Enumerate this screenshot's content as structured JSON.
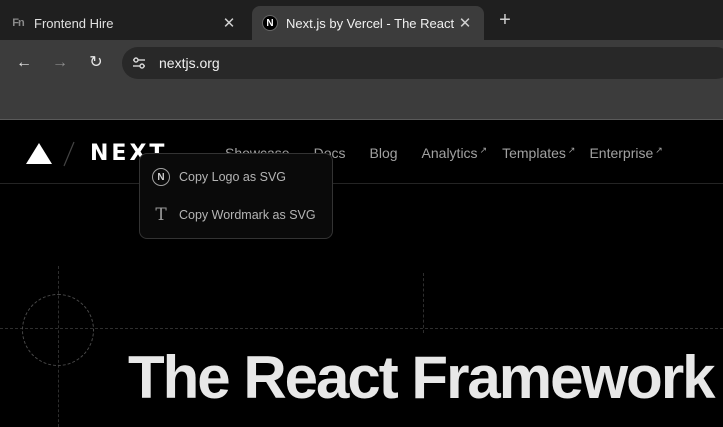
{
  "tabs": [
    {
      "favicon": "Fn",
      "title": "Frontend Hire",
      "close": "✕",
      "active": false
    },
    {
      "favicon": "N",
      "title": "Next.js by Vercel - The React",
      "close": "✕",
      "active": true
    }
  ],
  "new_tab": "+",
  "toolbar": {
    "back": "←",
    "forward": "→",
    "reload": "↻",
    "url": "nextjs.org"
  },
  "site": {
    "wordmark": "NEXT",
    "nav": [
      {
        "label": "Showcase",
        "external": false
      },
      {
        "label": "Docs",
        "external": false
      },
      {
        "label": "Blog",
        "external": false
      },
      {
        "label": "Analytics",
        "external": true
      },
      {
        "label": "Templates",
        "external": true
      },
      {
        "label": "Enterprise",
        "external": true
      }
    ],
    "ext_glyph": "↗",
    "hero_title": "The React Framework"
  },
  "context_menu": {
    "items": [
      {
        "icon": "nextjs-logo-icon",
        "glyph": "N",
        "label": "Copy Logo as SVG"
      },
      {
        "icon": "text-type-icon",
        "glyph": "T",
        "label": "Copy Wordmark as SVG"
      }
    ]
  },
  "colors": {
    "page_bg": "#000000",
    "chrome_bg": "#3c3c3c",
    "tabstrip_bg": "#1f1f1f",
    "nav_text": "#a1a1a1"
  }
}
